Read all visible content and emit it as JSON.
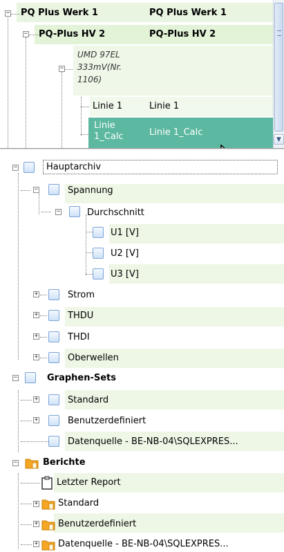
{
  "grid": {
    "rows": [
      {
        "name": "PQ Plus Werk 1",
        "value": "PQ Plus Werk 1"
      },
      {
        "name": "PQ-Plus HV 2",
        "value": "PQ-Plus HV 2"
      },
      {
        "device_lines": [
          "UMD 97EL",
          "333mV(Nr.",
          "1106)"
        ]
      },
      {
        "name": "Linie 1",
        "value": "Linie 1"
      },
      {
        "name_lines": [
          "Linie",
          "1_Calc"
        ],
        "value": "Linie 1_Calc"
      }
    ]
  },
  "tree": {
    "hauptarchiv": "Hauptarchiv",
    "spannung": "Spannung",
    "durchschnitt": "Durchschnitt",
    "u1": "U1 [V]",
    "u2": "U2 [V]",
    "u3": "U3 [V]",
    "strom": "Strom",
    "thdu": "THDU",
    "thdi": "THDI",
    "oberwellen": "Oberwellen",
    "graphen_sets": "Graphen-Sets",
    "standard": "Standard",
    "benutzerdefiniert": "Benutzerdefiniert",
    "datenquelle": "Datenquelle - BE-NB-04\\SQLEXPRES...",
    "berichte": "Berichte",
    "letzter_report": "Letzter Report",
    "b_standard": "Standard",
    "b_benutzerdefiniert": "Benutzerdefiniert",
    "b_datenquelle": "Datenquelle - BE-NB-04\\SQLEXPRES..."
  },
  "colors": {
    "band_green": "#eef7e6",
    "selected_teal": "#5cb8a0",
    "node_blue": "#cfe2f7",
    "folder_orange": "#f5a623"
  },
  "icons": {
    "expand": "plus-box-icon",
    "collapse": "minus-box-icon",
    "node": "blue-square-node-icon",
    "folder": "folder-icon",
    "report": "clipboard-report-icon"
  }
}
